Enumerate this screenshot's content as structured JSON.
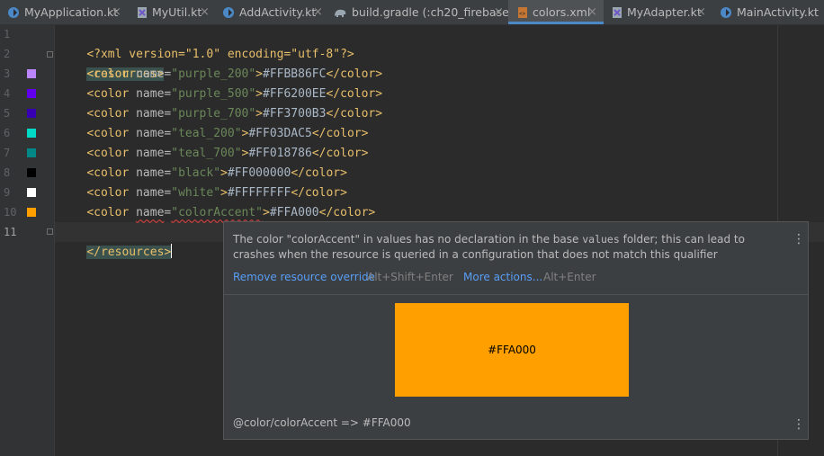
{
  "tabs": [
    {
      "label": "MyApplication.kt",
      "icon": "kotlin-file-icon",
      "active": false
    },
    {
      "label": "MyUtil.kt",
      "icon": "kotlin-file-icon",
      "active": false
    },
    {
      "label": "AddActivity.kt",
      "icon": "kotlin-class-icon",
      "active": false
    },
    {
      "label": "build.gradle (:ch20_firebase)",
      "icon": "gradle-elephant-icon",
      "active": false
    },
    {
      "label": "colors.xml",
      "icon": "xml-file-icon",
      "active": true
    },
    {
      "label": "MyAdapter.kt",
      "icon": "kotlin-file-icon",
      "active": false
    },
    {
      "label": "MainActivity.kt",
      "icon": "kotlin-class-icon",
      "active": false
    }
  ],
  "tab_close_glyph": "×",
  "editor": {
    "line_numbers": [
      "1",
      "2",
      "3",
      "4",
      "5",
      "6",
      "7",
      "8",
      "9",
      "10",
      "11"
    ],
    "current_line": "11",
    "decl": "<?xml version=\"1.0\" encoding=\"utf-8\"?>",
    "open_tag": "<resources>",
    "close_tag": "</resources>",
    "colors": [
      {
        "name": "purple_200",
        "value": "#FFBB86FC",
        "swatch": "#bb86fc"
      },
      {
        "name": "purple_500",
        "value": "#FF6200EE",
        "swatch": "#6200ee"
      },
      {
        "name": "purple_700",
        "value": "#FF3700B3",
        "swatch": "#3700b3"
      },
      {
        "name": "teal_200",
        "value": "#FF03DAC5",
        "swatch": "#03dac5"
      },
      {
        "name": "teal_700",
        "value": "#FF018786",
        "swatch": "#018786"
      },
      {
        "name": "black",
        "value": "#FF000000",
        "swatch": "#000000"
      },
      {
        "name": "white",
        "value": "#FFFFFFFF",
        "swatch": "#ffffff"
      },
      {
        "name": "colorAccent",
        "value": "#FFA000",
        "swatch": "#ffa000"
      }
    ]
  },
  "popup": {
    "message_part1": "The color \"colorAccent\" in values has no declaration in the base ",
    "message_code": "values",
    "message_part2": " folder; this can lead to crashes when the resource is queried in a configuration that does not match this qualifier",
    "action1_label": "Remove resource override",
    "action1_shortcut": "Alt+Shift+Enter",
    "action2_label": "More actions...",
    "action2_shortcut": "Alt+Enter",
    "preview_label": "#FFA000",
    "preview_color": "#ffa000",
    "footer": "@color/colorAccent => #FFA000",
    "kebab_glyph": "⋮"
  },
  "colors": {
    "accent": "#4a88c7",
    "tag": "#e8bf6a",
    "string": "#6a8759",
    "link": "#589df6"
  }
}
